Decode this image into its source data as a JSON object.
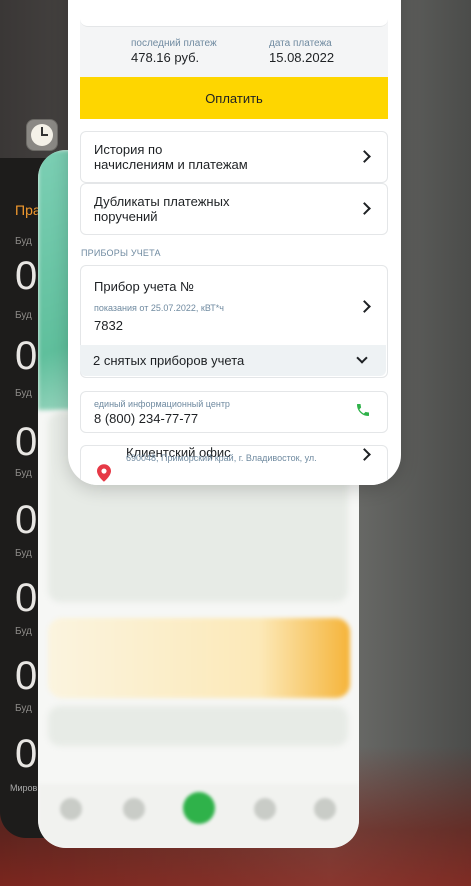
{
  "background_apps": {
    "clock_app": {
      "tab_title": "Пра",
      "alarm_prefix": "Буд",
      "alarm_rows": [
        {
          "digit": "0",
          "label": "Буд"
        },
        {
          "digit": "0",
          "label": "Буд"
        },
        {
          "digit": "0",
          "label": "Буд"
        },
        {
          "digit": "0",
          "label": "Буд"
        },
        {
          "digit": "0",
          "label": "Буд"
        },
        {
          "digit": "0",
          "label": "Буд"
        },
        {
          "digit": "0",
          "label": ""
        }
      ],
      "bottom_tab": "Миров"
    }
  },
  "payment": {
    "last_payment_label": "последний платеж",
    "last_payment_value": "478.16 руб.",
    "payment_date_label": "дата платежа",
    "payment_date_value": "15.08.2022",
    "pay_button": "Оплатить"
  },
  "menu": {
    "history": "История по начислениям и платежам",
    "history_line1": "История по",
    "history_line2": "начислениям и платежам",
    "duplicates_line1": "Дубликаты платежных",
    "duplicates_line2": "поручений"
  },
  "meters": {
    "section_title": "ПРИБОРЫ УЧЕТА",
    "meter_title": "Прибор учета №",
    "reading_caption": "показания от 25.07.2022, кВТ*ч",
    "reading_value": "7832",
    "removed_meters": "2 снятых приборов учета"
  },
  "contact": {
    "caption": "единый информационный центр",
    "phone": "8 (800) 234-77-77"
  },
  "office": {
    "title": "Клиентский офис",
    "address": "690048, Приморский край, г. Владивосток, ул."
  },
  "colors": {
    "accent_yellow": "#fed600",
    "label_blue_gray": "#6f8aa0",
    "phone_green": "#2fb24a",
    "pin_red": "#e63946"
  },
  "icons": {
    "clock": "clock-icon",
    "chevron": "chevron-right-icon",
    "chevron_down": "chevron-down-icon",
    "phone": "phone-icon",
    "location": "location-pin-icon"
  }
}
